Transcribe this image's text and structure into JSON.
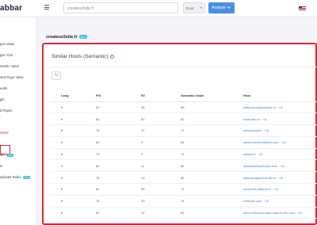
{
  "brand": {
    "logo_text": "abbar"
  },
  "header": {
    "search_value": "createur2site.fr",
    "select_value": "Root",
    "analyze_label": "Analyze"
  },
  "sidebar": {
    "items": [
      {
        "label": "ges Value"
      },
      {
        "label": "ges Your"
      },
      {
        "label": "mantic Value"
      },
      {
        "label": "rted Page Value"
      },
      {
        "label": "ealth"
      },
      {
        "label": "gin"
      },
      {
        "label": "d Pages"
      },
      {
        "label": "Hosts",
        "active": true
      },
      {
        "label": "ain",
        "badge": "new"
      },
      {
        "label": "ts"
      },
      {
        "label": "uplicate Radio",
        "badge": "new"
      }
    ]
  },
  "domain": {
    "title": "createur2site.fr",
    "badge": "Root"
  },
  "panel": {
    "title": "Similar Hosts (Semantic)",
    "reset_label": "↻",
    "columns": [
      "Lang",
      "PIV",
      "NT",
      "Semantic Value",
      "Host"
    ],
    "rows": [
      {
        "lang": "fr",
        "piv": "67",
        "nt": "36",
        "sv": "69",
        "host": "webbest-optimisation.fr"
      },
      {
        "lang": "fr",
        "piv": "84",
        "nt": "51",
        "sv": "82",
        "host": "www.ranc.fr"
      },
      {
        "lang": "fr",
        "piv": "76",
        "nt": "37",
        "sv": "77",
        "host": "www.siexia.fr"
      },
      {
        "lang": "fr",
        "piv": "84",
        "nt": "9",
        "sv": "84",
        "host": "www.chrestinebarbe.com"
      },
      {
        "lang": "fr",
        "piv": "70",
        "nt": "0",
        "sv": "71",
        "host": "adweb.fr"
      },
      {
        "lang": "fr",
        "piv": "69",
        "nt": "11",
        "sv": "62",
        "host": "adwebentreprenuer.com"
      },
      {
        "lang": "fr",
        "piv": "76",
        "nt": "13",
        "sv": "82",
        "host": "www.simplement-site.fr"
      },
      {
        "lang": "fr",
        "piv": "81",
        "nt": "60",
        "sv": "71",
        "host": "www.web-alliance.fr"
      },
      {
        "lang": "fr",
        "piv": "76",
        "nt": "33",
        "sv": "74",
        "host": "cresocis.com"
      },
      {
        "lang": "fr",
        "piv": "87",
        "nt": "12",
        "sv": "83",
        "host": "www.referencement-naturel-seo.com"
      }
    ]
  },
  "icons": {
    "info": "info-icon",
    "link": "external-link-icon",
    "flag": "us-flag-icon"
  },
  "colors": {
    "accent": "#4a8fe0",
    "highlight": "#d42a3a",
    "badge": "#3ec1d3"
  }
}
